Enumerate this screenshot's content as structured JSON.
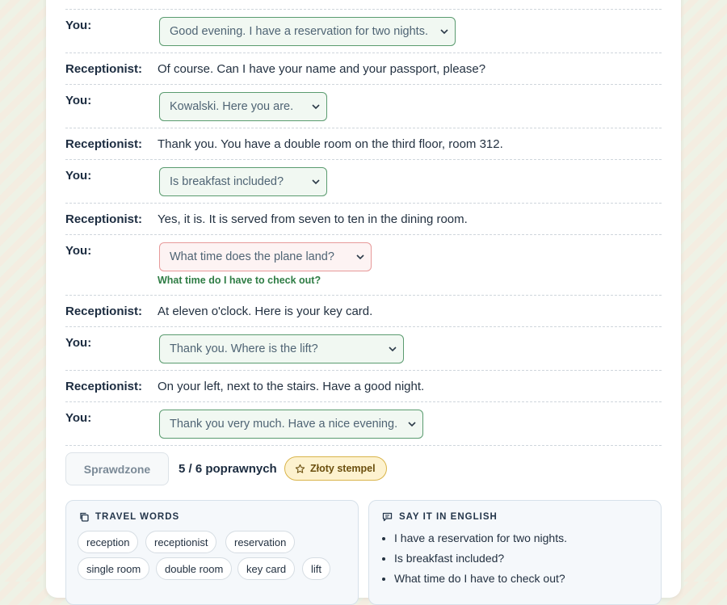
{
  "dialogue": [
    {
      "speaker": "You:",
      "type": "select",
      "value": "Good evening. I have a reservation for two nights.",
      "state": "correct"
    },
    {
      "speaker": "Receptionist:",
      "type": "line",
      "text": "Of course. Can I have your name and your passport, please?"
    },
    {
      "speaker": "You:",
      "type": "select",
      "value": "Kowalski. Here you are.",
      "state": "correct"
    },
    {
      "speaker": "Receptionist:",
      "type": "line",
      "text": "Thank you. You have a double room on the third floor, room 312."
    },
    {
      "speaker": "You:",
      "type": "select",
      "value": "Is breakfast included?",
      "state": "correct"
    },
    {
      "speaker": "Receptionist:",
      "type": "line",
      "text": "Yes, it is. It is served from seven to ten in the dining room."
    },
    {
      "speaker": "You:",
      "type": "select",
      "value": "What time does the plane land?",
      "state": "wrong",
      "correction": "What time do I have to check out?"
    },
    {
      "speaker": "Receptionist:",
      "type": "line",
      "text": "At eleven o'clock. Here is your key card."
    },
    {
      "speaker": "You:",
      "type": "select",
      "value": "Thank you. Where is the lift?",
      "state": "correct"
    },
    {
      "speaker": "Receptionist:",
      "type": "line",
      "text": "On your left, next to the stairs. Have a good night."
    },
    {
      "speaker": "You:",
      "type": "select",
      "value": "Thank you very much. Have a nice evening.",
      "state": "correct"
    }
  ],
  "actions": {
    "checked_label": "Sprawdzone",
    "score_text": "5 / 6 poprawnych",
    "badge_label": "Złoty stempel"
  },
  "travel_words": {
    "title": "TRAVEL WORDS",
    "words": [
      "reception",
      "receptionist",
      "reservation",
      "single room",
      "double room",
      "key card",
      "lift"
    ]
  },
  "say_it": {
    "title": "SAY IT IN ENGLISH",
    "phrases": [
      "I have a reservation for two nights.",
      "Is breakfast included?",
      "What time do I have to check out?"
    ]
  },
  "colors": {
    "correct_border": "#5a9b6f",
    "wrong_border": "#e79a9a",
    "hint_text": "#2f7d45",
    "badge_bg": "#fdf2cf"
  }
}
